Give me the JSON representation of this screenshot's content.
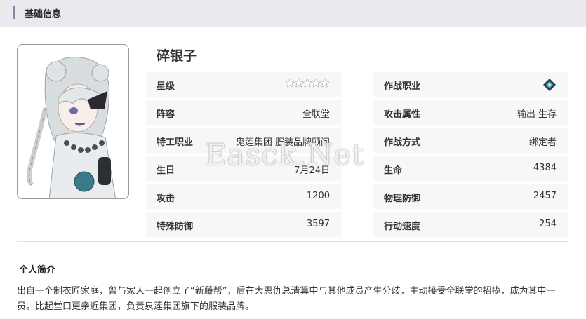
{
  "section": {
    "title": "基础信息"
  },
  "character": {
    "name": "碎银子",
    "portrait_icon": "character-portrait"
  },
  "stats_left": [
    {
      "label": "星级",
      "value": "★★★★★",
      "rarity": 5
    },
    {
      "label": "阵容",
      "value": "全联堂"
    },
    {
      "label": "特工职业",
      "value": "鬼莲集团 服装品牌顾问"
    },
    {
      "label": "生日",
      "value": "7月24日"
    },
    {
      "label": "攻击",
      "value": "1200"
    },
    {
      "label": "特殊防御",
      "value": "3597"
    }
  ],
  "stats_right": [
    {
      "label": "作战职业",
      "value": "",
      "icon": "class-diamond-icon"
    },
    {
      "label": "攻击属性",
      "value": "输出 生存"
    },
    {
      "label": "作战方式",
      "value": "绑定者"
    },
    {
      "label": "生命",
      "value": "4384"
    },
    {
      "label": "物理防御",
      "value": "2457"
    },
    {
      "label": "行动速度",
      "value": "254"
    }
  ],
  "intro": {
    "title": "个人简介",
    "text": "出自一个制衣匠家庭，曾与家人一起创立了“新藤帮”，后在大恩仇总清算中与其他成员产生分歧，主动接受全联堂的招揽，成为其中一员。比起堂口更亲近集团，负责泉莲集团旗下的服装品牌。"
  },
  "watermark": "Easck.Net",
  "colors": {
    "accent": "#8a84a6",
    "row_bg": "#f7f7f7",
    "header_bg": "#e9e9ee"
  }
}
